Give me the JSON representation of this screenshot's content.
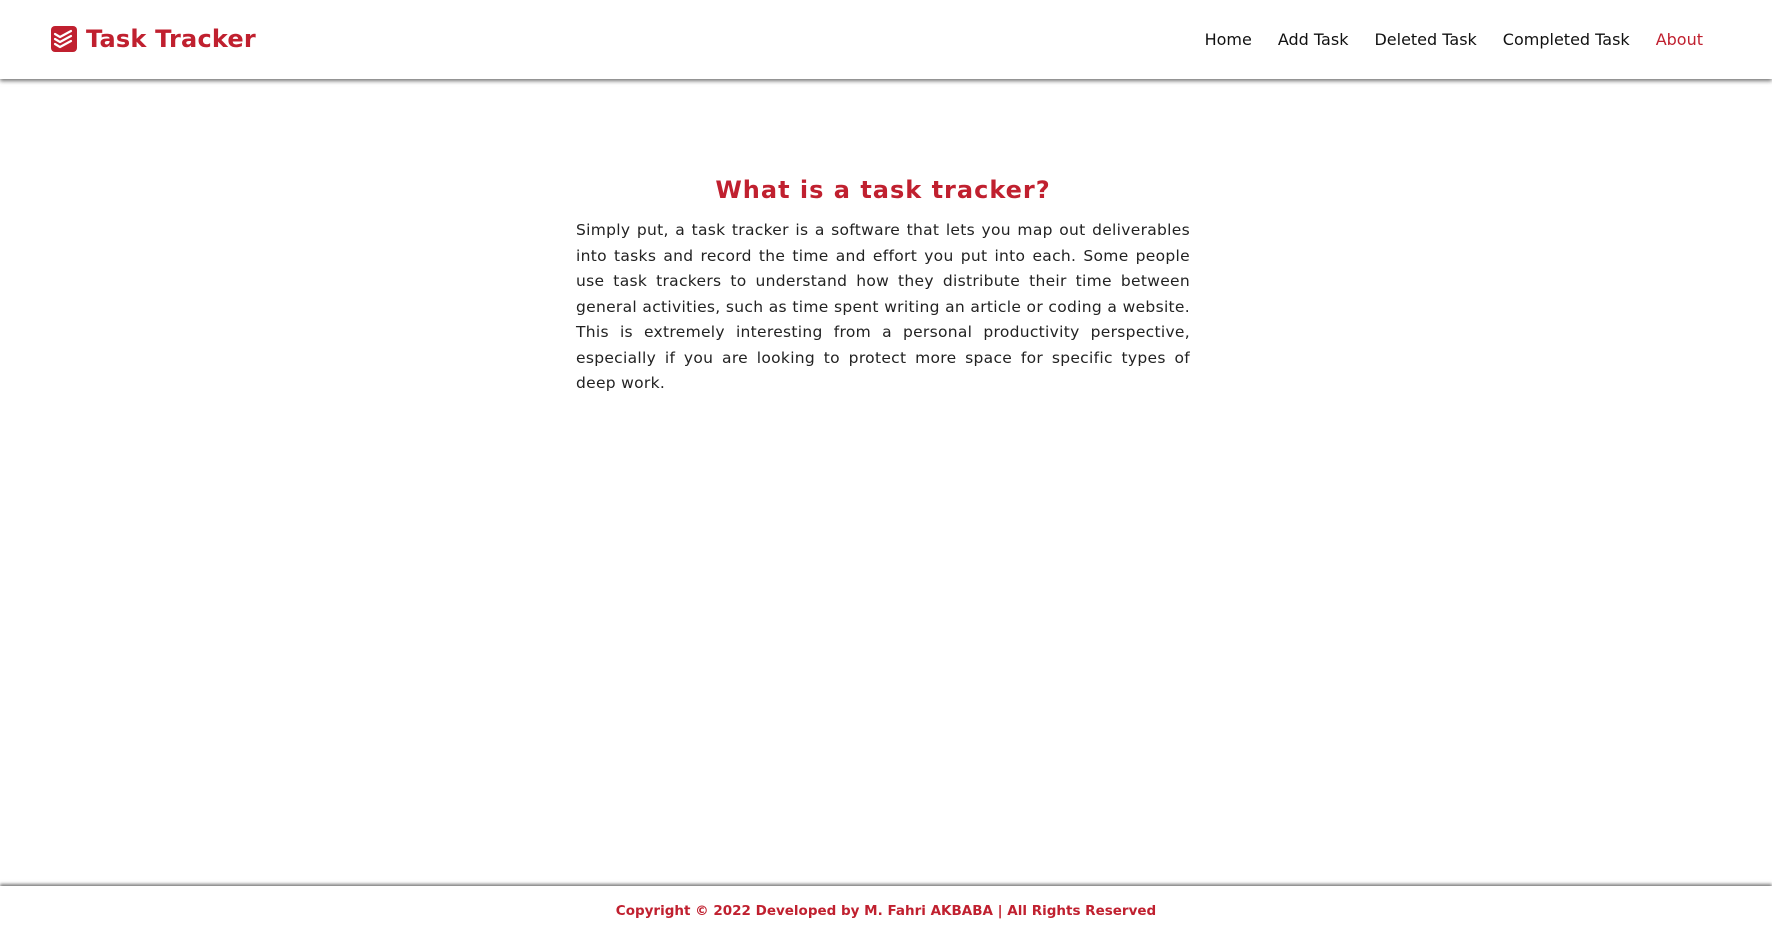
{
  "colors": {
    "accent": "#c0202f",
    "text": "#111111"
  },
  "navbar": {
    "brand": {
      "icon": "todoist-logo-icon",
      "title": "Task Tracker"
    },
    "links": [
      {
        "label": "Home",
        "active": false
      },
      {
        "label": "Add Task",
        "active": false
      },
      {
        "label": "Deleted Task",
        "active": false
      },
      {
        "label": "Completed Task",
        "active": false
      },
      {
        "label": "About",
        "active": true
      }
    ]
  },
  "main": {
    "title": "What is a task tracker?",
    "paragraph": "Simply put, a task tracker is a software that lets you map out deliverables into tasks and record the time and effort you put into each. Some people use task trackers to understand how they distribute their time between general activities, such as time spent writing an article or coding a website. This is extremely interesting from a personal productivity perspective, especially if you are looking to protect more space for specific types of deep work."
  },
  "footer": {
    "text": "Copyright © 2022 Developed by M. Fahri AKBABA | All Rights Reserved"
  }
}
